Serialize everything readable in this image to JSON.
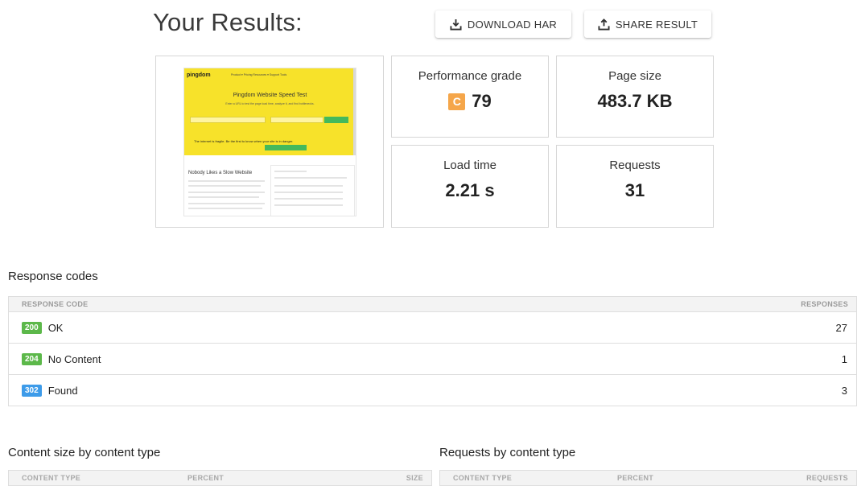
{
  "header": {
    "title": "Your Results:",
    "download_label": "DOWNLOAD HAR",
    "share_label": "SHARE RESULT"
  },
  "thumbnail": {
    "logo": "pingdom",
    "nav": "Product ▾   Pricing   Resources ▾   Support   Tools",
    "heading": "Pingdom Website Speed Test",
    "subheading": "Enter a URL to test the page load time, analyze it, and find bottlenecks.",
    "banner": "The internet is fragile. Be the first to know when your site is in danger.",
    "section_heading": "Nobody Likes a Slow Website"
  },
  "metrics": {
    "performance": {
      "label": "Performance grade",
      "grade": "C",
      "value": "79",
      "grade_color": "#f5a64a"
    },
    "page_size": {
      "label": "Page size",
      "value": "483.7 KB"
    },
    "load_time": {
      "label": "Load time",
      "value": "2.21 s"
    },
    "requests": {
      "label": "Requests",
      "value": "31"
    }
  },
  "response_codes": {
    "heading": "Response codes",
    "col_code": "RESPONSE CODE",
    "col_responses": "RESPONSES",
    "rows": [
      {
        "code": "200",
        "text": "OK",
        "count": "27",
        "color": "#5cb84a"
      },
      {
        "code": "204",
        "text": "No Content",
        "count": "1",
        "color": "#5cb84a"
      },
      {
        "code": "302",
        "text": "Found",
        "count": "3",
        "color": "#3d9be9"
      }
    ]
  },
  "content_size": {
    "heading": "Content size by content type",
    "col_type": "CONTENT TYPE",
    "col_percent": "PERCENT",
    "col_size": "SIZE"
  },
  "requests_by_type": {
    "heading": "Requests by content type",
    "col_type": "CONTENT TYPE",
    "col_percent": "PERCENT",
    "col_requests": "REQUESTS"
  },
  "icons": {
    "download": "download-icon",
    "share": "share-icon"
  }
}
